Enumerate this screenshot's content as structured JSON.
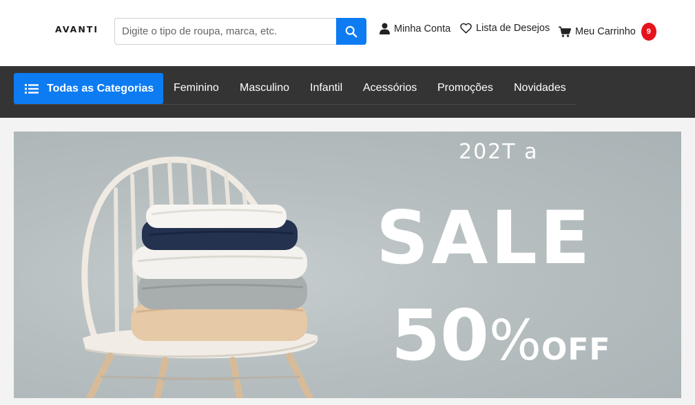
{
  "header": {
    "logo": "AVANTI",
    "search": {
      "placeholder": "Digite o tipo de roupa, marca, etc.",
      "value": ""
    },
    "account_label": "Minha Conta",
    "wishlist_label": "Lista de Desejos",
    "cart_label": "Meu Carrinho",
    "cart_count": "9"
  },
  "nav": {
    "all_categories": "Todas as Categorias",
    "items": [
      {
        "label": "Feminino"
      },
      {
        "label": "Masculino"
      },
      {
        "label": "Infantil"
      },
      {
        "label": "Acessórios"
      },
      {
        "label": "Promoções"
      },
      {
        "label": "Novidades"
      }
    ]
  },
  "banner": {
    "year_text": "202T a",
    "sale": "SALE",
    "percent": "50",
    "percent_sign": "%",
    "off": "OFF"
  },
  "colors": {
    "accent": "#0d7cf2",
    "navbar": "#343434",
    "badge": "#e5141c",
    "banner_bg": "#b6bec0"
  },
  "icons": [
    "search-icon",
    "user-icon",
    "heart-icon",
    "cart-icon",
    "menu-list-icon"
  ]
}
